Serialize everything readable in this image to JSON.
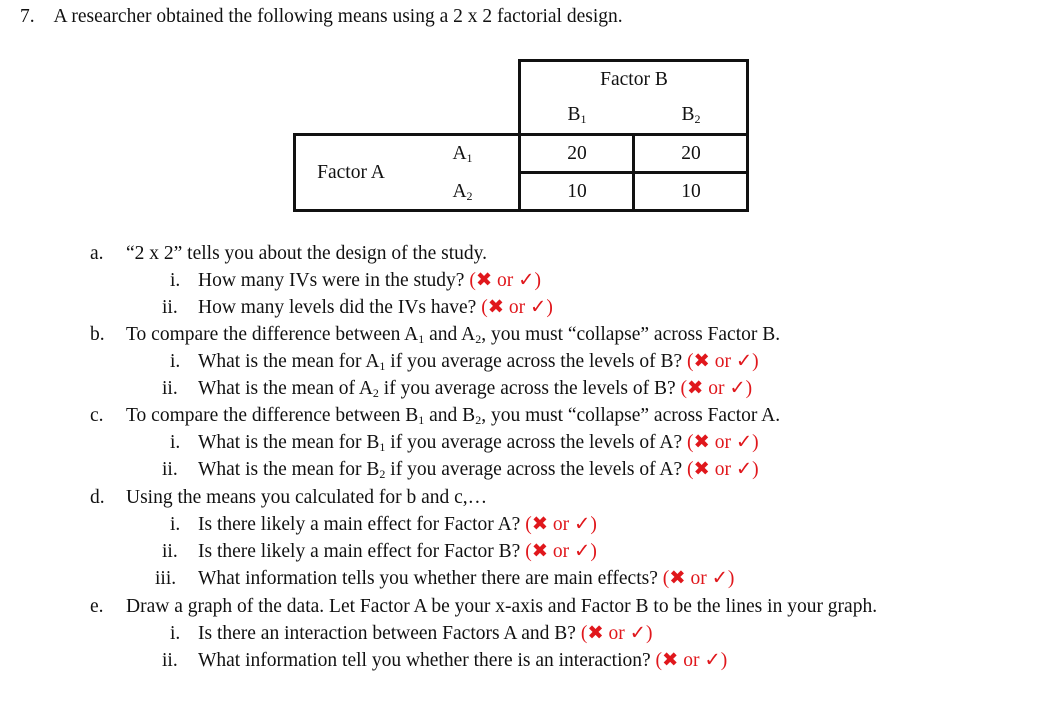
{
  "question": {
    "number": "7.",
    "text": "A researcher obtained the following means using a 2 x 2 factorial design."
  },
  "table": {
    "col_factor": "Factor B",
    "col_levels": [
      {
        "base": "B",
        "sub": "1"
      },
      {
        "base": "B",
        "sub": "2"
      }
    ],
    "row_factor": "Factor A",
    "row_levels": [
      {
        "base": "A",
        "sub": "1"
      },
      {
        "base": "A",
        "sub": "2"
      }
    ],
    "cells": [
      [
        "20",
        "20"
      ],
      [
        "10",
        "10"
      ]
    ]
  },
  "mark_text": "(✖ or ✓)",
  "parts": [
    {
      "label": "a.",
      "text": "“2 x 2” tells you about the design of the study.",
      "items": [
        {
          "label": "i.",
          "text": "How many IVs were in the study?"
        },
        {
          "label": "ii.",
          "text": "How many levels did the IVs have?"
        }
      ]
    },
    {
      "label": "b.",
      "text_parts": [
        "To compare the difference between A",
        "1",
        " and A",
        "2",
        ", you must “collapse” across Factor B."
      ],
      "items": [
        {
          "label": "i.",
          "text_parts": [
            "What is the mean for A",
            "1",
            " if you average across the levels of B?"
          ]
        },
        {
          "label": "ii.",
          "text_parts": [
            "What is the mean of A",
            "2",
            " if you average across the levels of B?"
          ]
        }
      ]
    },
    {
      "label": "c.",
      "text_parts": [
        "To compare the difference between B",
        "1",
        " and B",
        "2",
        ", you must “collapse” across Factor A."
      ],
      "items": [
        {
          "label": "i.",
          "text_parts": [
            "What is the mean for B",
            "1",
            " if you average across the levels of A?"
          ]
        },
        {
          "label": "ii.",
          "text_parts": [
            "What is the mean for B",
            "2",
            " if you average across the levels of A?"
          ]
        }
      ]
    },
    {
      "label": "d.",
      "text": "Using the means you calculated for b and c,…",
      "items": [
        {
          "label": "i.",
          "text": "Is there likely a main effect for Factor A?"
        },
        {
          "label": "ii.",
          "text": "Is there likely a main effect for Factor B?"
        },
        {
          "label": "iii.",
          "text": "What information tells you whether there are main effects?"
        }
      ]
    },
    {
      "label": "e.",
      "text": "Draw a graph of the data. Let Factor A be your x-axis and Factor B to be the lines in your graph.",
      "items": [
        {
          "label": "i.",
          "text": "Is there an interaction between Factors A and B?"
        },
        {
          "label": "ii.",
          "text": "What information tell you whether there is an interaction?"
        }
      ]
    }
  ]
}
